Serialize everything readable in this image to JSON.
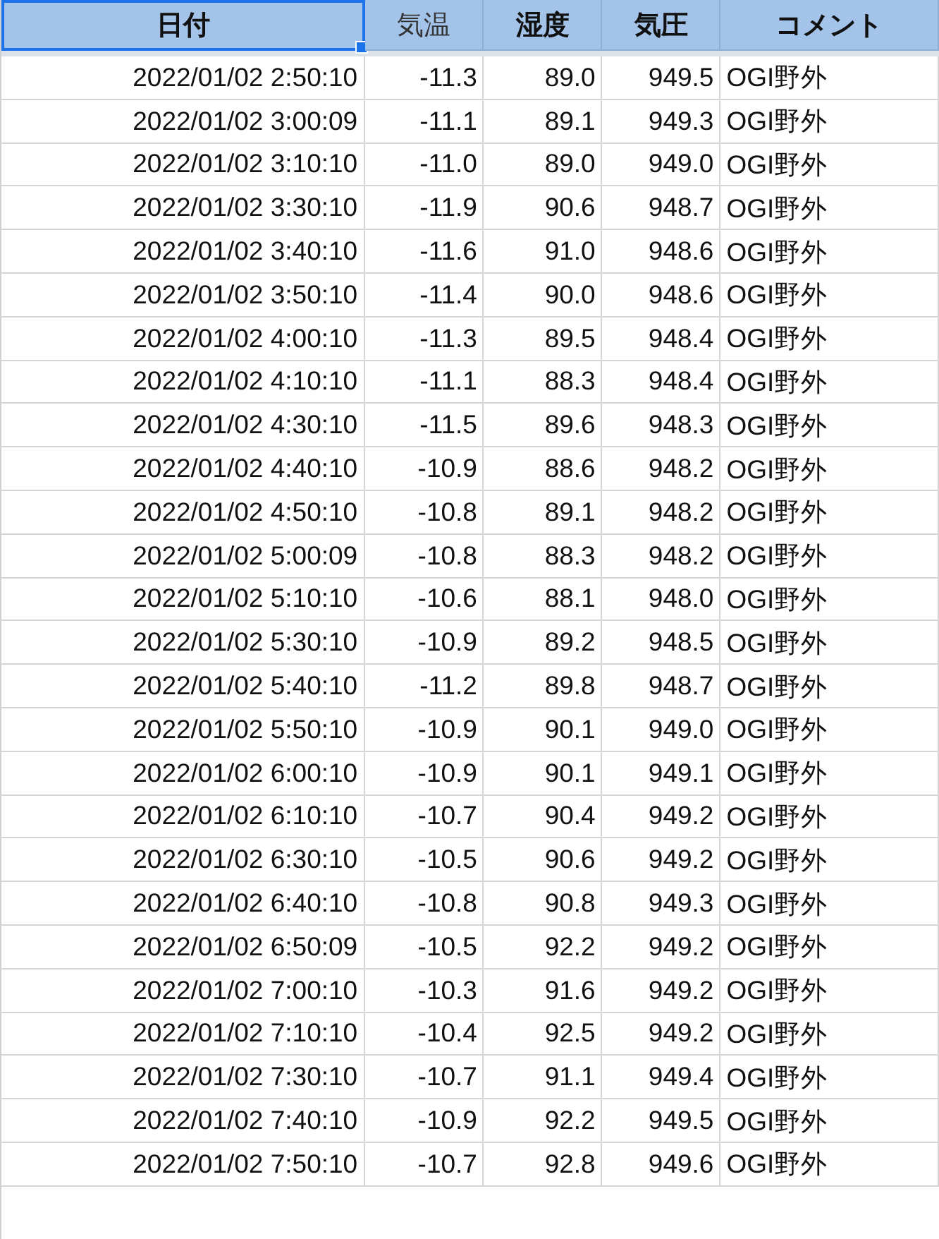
{
  "columns": [
    {
      "label": "日付",
      "bold": true,
      "selected": true
    },
    {
      "label": "気温",
      "bold": false,
      "selected": false
    },
    {
      "label": "湿度",
      "bold": true,
      "selected": false
    },
    {
      "label": "気圧",
      "bold": true,
      "selected": false
    },
    {
      "label": "コメント",
      "bold": true,
      "selected": false
    }
  ],
  "rows": [
    [
      "2022/01/02 2:50:10",
      "-11.3",
      "89.0",
      "949.5",
      "OGI野外"
    ],
    [
      "2022/01/02 3:00:09",
      "-11.1",
      "89.1",
      "949.3",
      "OGI野外"
    ],
    [
      "2022/01/02 3:10:10",
      "-11.0",
      "89.0",
      "949.0",
      "OGI野外"
    ],
    [
      "2022/01/02 3:30:10",
      "-11.9",
      "90.6",
      "948.7",
      "OGI野外"
    ],
    [
      "2022/01/02 3:40:10",
      "-11.6",
      "91.0",
      "948.6",
      "OGI野外"
    ],
    [
      "2022/01/02 3:50:10",
      "-11.4",
      "90.0",
      "948.6",
      "OGI野外"
    ],
    [
      "2022/01/02 4:00:10",
      "-11.3",
      "89.5",
      "948.4",
      "OGI野外"
    ],
    [
      "2022/01/02 4:10:10",
      "-11.1",
      "88.3",
      "948.4",
      "OGI野外"
    ],
    [
      "2022/01/02 4:30:10",
      "-11.5",
      "89.6",
      "948.3",
      "OGI野外"
    ],
    [
      "2022/01/02 4:40:10",
      "-10.9",
      "88.6",
      "948.2",
      "OGI野外"
    ],
    [
      "2022/01/02 4:50:10",
      "-10.8",
      "89.1",
      "948.2",
      "OGI野外"
    ],
    [
      "2022/01/02 5:00:09",
      "-10.8",
      "88.3",
      "948.2",
      "OGI野外"
    ],
    [
      "2022/01/02 5:10:10",
      "-10.6",
      "88.1",
      "948.0",
      "OGI野外"
    ],
    [
      "2022/01/02 5:30:10",
      "-10.9",
      "89.2",
      "948.5",
      "OGI野外"
    ],
    [
      "2022/01/02 5:40:10",
      "-11.2",
      "89.8",
      "948.7",
      "OGI野外"
    ],
    [
      "2022/01/02 5:50:10",
      "-10.9",
      "90.1",
      "949.0",
      "OGI野外"
    ],
    [
      "2022/01/02 6:00:10",
      "-10.9",
      "90.1",
      "949.1",
      "OGI野外"
    ],
    [
      "2022/01/02 6:10:10",
      "-10.7",
      "90.4",
      "949.2",
      "OGI野外"
    ],
    [
      "2022/01/02 6:30:10",
      "-10.5",
      "90.6",
      "949.2",
      "OGI野外"
    ],
    [
      "2022/01/02 6:40:10",
      "-10.8",
      "90.8",
      "949.3",
      "OGI野外"
    ],
    [
      "2022/01/02 6:50:09",
      "-10.5",
      "92.2",
      "949.2",
      "OGI野外"
    ],
    [
      "2022/01/02 7:00:10",
      "-10.3",
      "91.6",
      "949.2",
      "OGI野外"
    ],
    [
      "2022/01/02 7:10:10",
      "-10.4",
      "92.5",
      "949.2",
      "OGI野外"
    ],
    [
      "2022/01/02 7:30:10",
      "-10.7",
      "91.1",
      "949.4",
      "OGI野外"
    ],
    [
      "2022/01/02 7:40:10",
      "-10.9",
      "92.2",
      "949.5",
      "OGI野外"
    ],
    [
      "2022/01/02 7:50:10",
      "-10.7",
      "92.8",
      "949.6",
      "OGI野外"
    ]
  ]
}
